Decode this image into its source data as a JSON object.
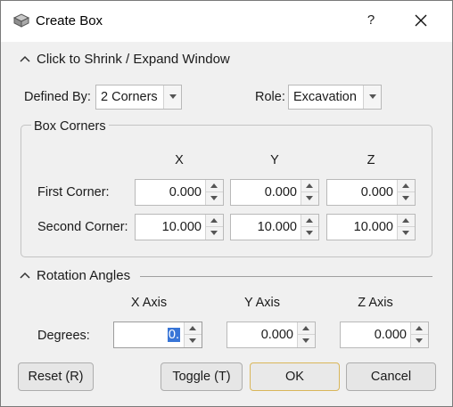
{
  "window": {
    "title": "Create Box",
    "help_label": "?",
    "icons": [
      "box-icon",
      "close-icon"
    ]
  },
  "shrink": {
    "label": "Click to Shrink / Expand Window"
  },
  "defined_by": {
    "label": "Defined By:",
    "value": "2 Corners"
  },
  "role": {
    "label": "Role:",
    "value": "Excavation"
  },
  "box_corners": {
    "title": "Box Corners",
    "columns": [
      "X",
      "Y",
      "Z"
    ],
    "rows": [
      {
        "label": "First Corner:",
        "values": [
          "0.000",
          "0.000",
          "0.000"
        ]
      },
      {
        "label": "Second Corner:",
        "values": [
          "10.000",
          "10.000",
          "10.000"
        ]
      }
    ]
  },
  "rotation": {
    "title": "Rotation Angles",
    "columns": [
      "X Axis",
      "Y Axis",
      "Z Axis"
    ],
    "row_label": "Degrees:",
    "values": [
      "0.",
      "0.000",
      "0.000"
    ]
  },
  "buttons": {
    "reset": "Reset (R)",
    "toggle": "Toggle (T)",
    "ok": "OK",
    "cancel": "Cancel"
  },
  "colors": {
    "dialog_bg": "#f0f0f0",
    "selection": "#3875d7",
    "default_button_border": "#d9b65a"
  }
}
